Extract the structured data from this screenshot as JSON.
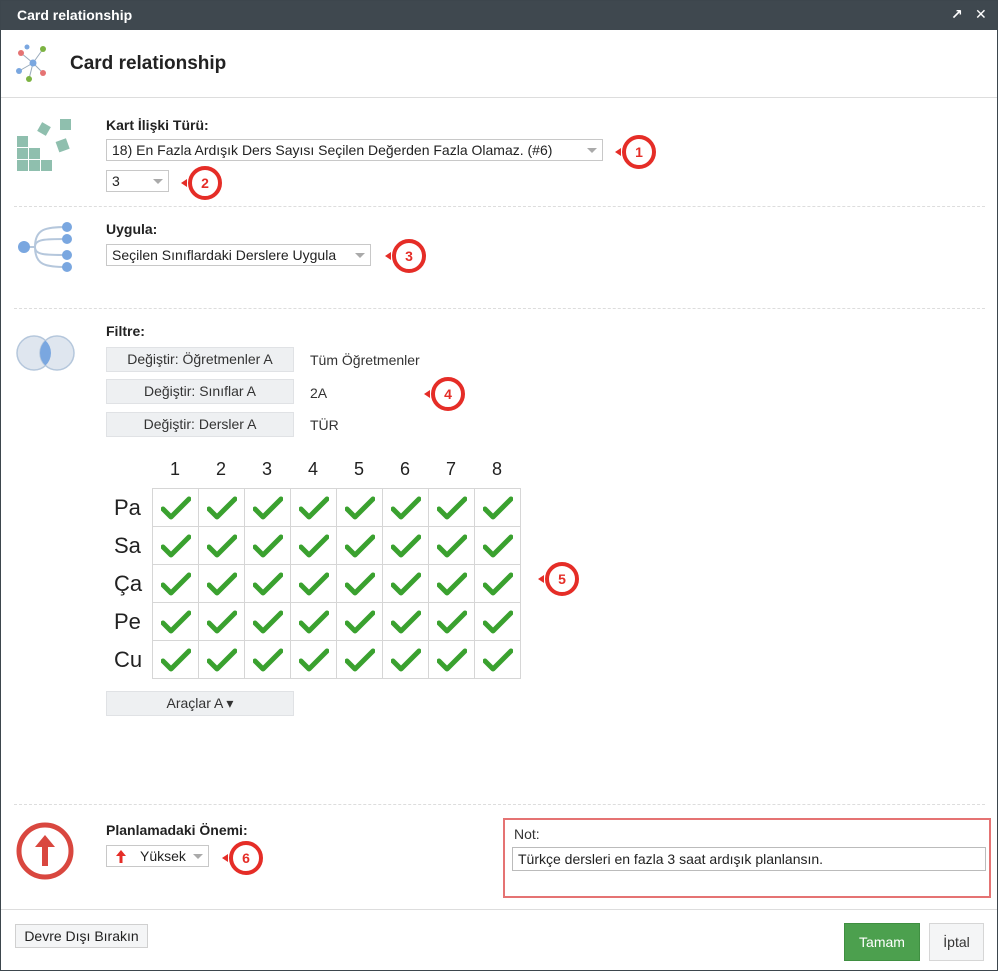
{
  "window": {
    "title": "Card relationship",
    "header_title": "Card relationship"
  },
  "relationship": {
    "label": "Kart İlişki Türü:",
    "type_value": "18) En Fazla Ardışık Ders Sayısı Seçilen Değerden Fazla Olamaz. (#6)",
    "count_value": "3"
  },
  "apply": {
    "label": "Uygula:",
    "value": "Seçilen Sınıflardaki Derslere Uygula"
  },
  "filter": {
    "label": "Filtre:",
    "rows": [
      {
        "button": "Değiştir: Öğretmenler A",
        "value": "Tüm Öğretmenler"
      },
      {
        "button": "Değiştir: Sınıflar A",
        "value": "2A"
      },
      {
        "button": "Değiştir: Dersler A",
        "value": "TÜR"
      }
    ]
  },
  "grid": {
    "columns": [
      "1",
      "2",
      "3",
      "4",
      "5",
      "6",
      "7",
      "8"
    ],
    "rows": [
      "Pa",
      "Sa",
      "Ça",
      "Pe",
      "Cu"
    ],
    "all_checked": true
  },
  "tools_button": "Araçlar A ▾",
  "importance": {
    "label": "Planlamadaki Önemi:",
    "value": "Yüksek"
  },
  "note": {
    "label": "Not:",
    "value": "Türkçe dersleri en fazla 3 saat ardışık planlansın."
  },
  "badges": [
    "1",
    "2",
    "3",
    "4",
    "5",
    "6"
  ],
  "footer": {
    "disable_label": "Devre Dışı Bırakın",
    "ok_label": "Tamam",
    "cancel_label": "İptal"
  },
  "colors": {
    "titlebar": "#3f484f",
    "accent_red": "#e52d27",
    "check_green": "#3aa12f",
    "ok_green": "#4ca04e",
    "icon_teal": "#8fbfae",
    "icon_blue": "#7aa7e0"
  },
  "icons": {
    "maximize": "↗",
    "close": "✕"
  }
}
